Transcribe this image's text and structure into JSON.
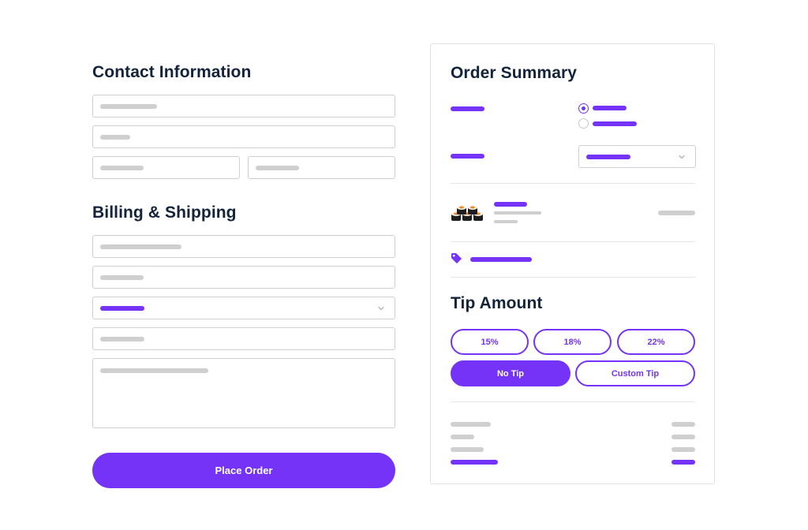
{
  "contact": {
    "heading": "Contact Information"
  },
  "billing": {
    "heading": "Billing & Shipping"
  },
  "place_order_label": "Place Order",
  "summary": {
    "heading": "Order Summary"
  },
  "tip": {
    "heading": "Tip Amount",
    "options": [
      "15%",
      "18%",
      "22%",
      "No Tip",
      "Custom Tip"
    ],
    "selected": "No Tip"
  },
  "icons": {
    "product": "sushi-rolls-icon",
    "promo": "price-tag-icon",
    "dropdown": "chevron-down-icon"
  },
  "colors": {
    "accent": "#7433f7",
    "heading": "#13233a",
    "placeholder": "#cfcfcf",
    "border": "#cfcfcf"
  }
}
